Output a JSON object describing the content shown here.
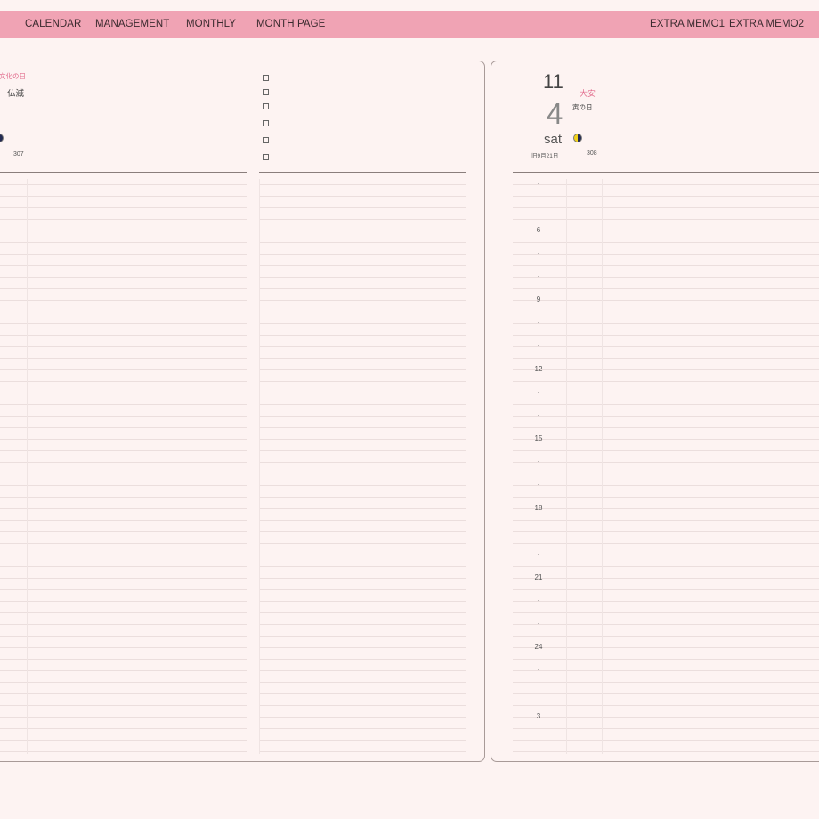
{
  "nav": {
    "left": [
      {
        "id": "calendar",
        "label": "CALENDAR"
      },
      {
        "id": "management",
        "label": "MANAGEMENT"
      },
      {
        "id": "monthly",
        "label": "MONTHLY"
      },
      {
        "id": "month-page",
        "label": "MONTH PAGE"
      }
    ],
    "right": [
      {
        "id": "extra-memo1",
        "label": "EXTRA MEMO1"
      },
      {
        "id": "extra-memo2",
        "label": "EXTRA MEMO2"
      }
    ]
  },
  "left_page": {
    "holiday": "文化の日",
    "rokuyo": "仏滅",
    "day_of_year": "307",
    "moon_icon": "half-moon-icon",
    "checkbox_count": 6
  },
  "right_page": {
    "month": "11",
    "day": "4",
    "weekday": "sat",
    "rokuyo": "大安",
    "eto_day": "寅の日",
    "lunar_date": "旧9月21日",
    "day_of_year": "308",
    "moon_icon": "half-moon-icon",
    "hours": [
      "·",
      "·",
      "6",
      "·",
      "·",
      "9",
      "·",
      "·",
      "12",
      "·",
      "·",
      "15",
      "·",
      "·",
      "18",
      "·",
      "·",
      "21",
      "·",
      "·",
      "24",
      "·",
      "·",
      "3"
    ]
  },
  "colors": {
    "nav_bg": "#f0a3b4",
    "page_bg": "#fdf3f2",
    "accent_pink": "#e26d8d",
    "border": "#a89a98"
  }
}
